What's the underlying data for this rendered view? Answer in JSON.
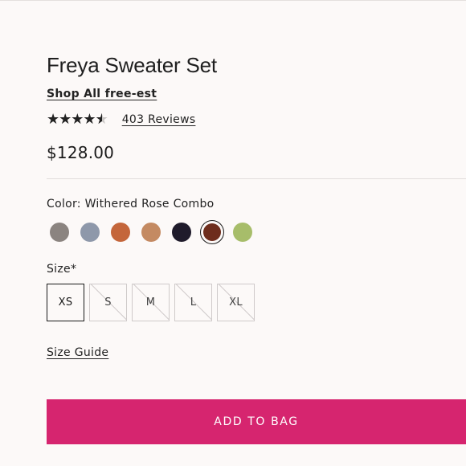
{
  "product": {
    "title": "Freya Sweater Set",
    "shop_link": "Shop All free-est",
    "rating": 4.5,
    "rating_max": 5,
    "reviews_link": "403 Reviews",
    "price": "$128.00"
  },
  "color": {
    "label": "Color: Withered Rose Combo",
    "swatches": [
      {
        "name": "swatch-grey",
        "bg": "#8b8480"
      },
      {
        "name": "swatch-blue-grey",
        "bg": "#8e98aa"
      },
      {
        "name": "swatch-rust",
        "bg": "#c4663b"
      },
      {
        "name": "swatch-tan",
        "bg": "#c48a62"
      },
      {
        "name": "swatch-navy",
        "bg": "#1f1b2b"
      },
      {
        "name": "swatch-withered-rose",
        "bg": "#6e2d1d",
        "selected": true
      },
      {
        "name": "swatch-green",
        "bg": "#a7bd6a"
      }
    ]
  },
  "size": {
    "label": "Size*",
    "options": [
      {
        "label": "XS",
        "available": true,
        "selected": true
      },
      {
        "label": "S",
        "available": false
      },
      {
        "label": "M",
        "available": false
      },
      {
        "label": "L",
        "available": false
      },
      {
        "label": "XL",
        "available": false
      }
    ],
    "guide_link": "Size Guide"
  },
  "cart": {
    "add_label": "ADD TO BAG",
    "accent": "#d6256f"
  }
}
